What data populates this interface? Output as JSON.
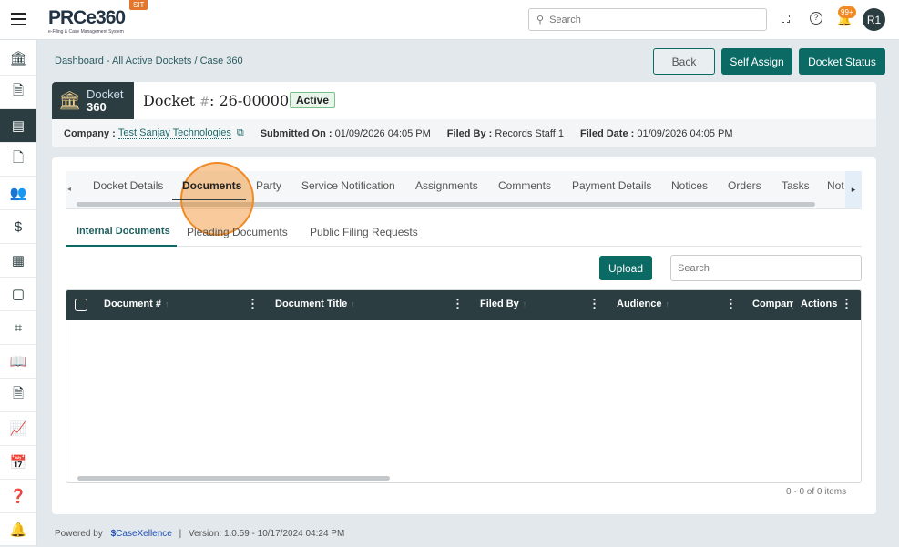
{
  "header": {
    "app_name": "PRCe360",
    "app_tagline": "e-Filing & Case Management System",
    "env_badge": "SIT",
    "search_placeholder": "Search",
    "notification_count": "99+",
    "avatar_initials": "R1"
  },
  "sidebar": {
    "icons": [
      "bank-icon",
      "document-icon",
      "comment-icon",
      "document-search-icon",
      "users-icon",
      "dollar-document-icon",
      "building-icon",
      "note-icon",
      "scan-icon",
      "book-icon",
      "file-icon",
      "chart-icon",
      "calendar-icon",
      "help-book-icon",
      "alarm-icon"
    ],
    "active_index": 2
  },
  "breadcrumb": "Dashboard - All Active Dockets / Case 360",
  "actions": {
    "back": "Back",
    "self_assign": "Self Assign",
    "docket_status": "Docket Status"
  },
  "docket": {
    "badge_line1": "Docket",
    "badge_line2": "360",
    "title_prefix": "Docket",
    "hash": "#",
    "title_number": ": 26-0000075",
    "status": "Active",
    "company_label": "Company :",
    "company": "Test Sanjay Technologies",
    "submitted_label": "Submitted On :",
    "submitted": "01/09/2026 04:05 PM",
    "filed_by_label": "Filed By :",
    "filed_by": "Records Staff 1",
    "filed_date_label": "Filed Date :",
    "filed_date": "01/09/2026 04:05 PM"
  },
  "tabs": [
    "Docket Details",
    "Documents",
    "Party",
    "Service Notification",
    "Assignments",
    "Comments",
    "Payment Details",
    "Notices",
    "Orders",
    "Tasks",
    "Not"
  ],
  "active_tab": "Documents",
  "subtabs": [
    "Internal Documents",
    "Pleading Documents",
    "Public Filing Requests"
  ],
  "upload": "Upload",
  "table_search_placeholder": "Search",
  "columns": [
    "Document #",
    "Document Title",
    "Filed By",
    "Audience",
    "Company",
    "Actions"
  ],
  "pager": "0 - 0 of 0 items",
  "footer": {
    "powered_by": "Powered by",
    "brand": "CaseXellence",
    "sep": "|",
    "version": "Version: 1.0.59 - 10/17/2024 04:24 PM"
  },
  "colors": {
    "primary": "#0c6a64",
    "dark": "#2b3d41",
    "orange": "#f08a24"
  }
}
